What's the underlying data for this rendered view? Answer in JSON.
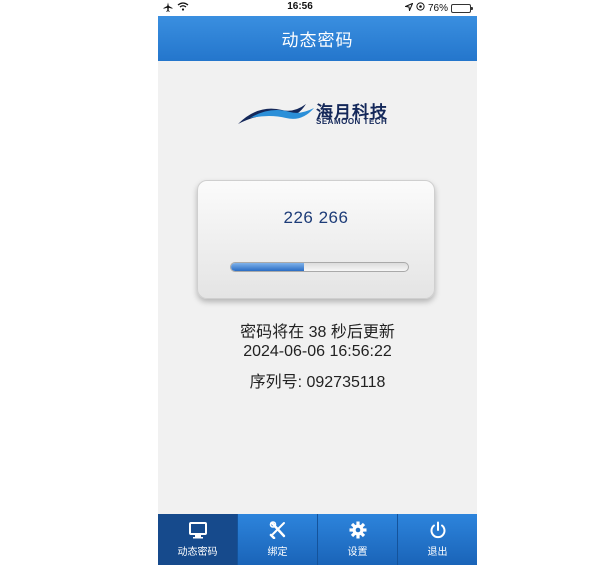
{
  "status_bar": {
    "time": "16:56",
    "battery": "76%",
    "battery_level": 0.76
  },
  "header": {
    "title": "动态密码"
  },
  "logo": {
    "name_cn": "海月科技",
    "name_en": "SEAMOON TECH"
  },
  "token": {
    "code": "226 266",
    "progress": 0.41
  },
  "info": {
    "refresh_text": "密码将在 38 秒后更新",
    "datetime": "2024-06-06 16:56:22",
    "serial": "序列号: 092735118"
  },
  "tabs": [
    {
      "label": "动态密码",
      "icon": "monitor-icon",
      "active": true
    },
    {
      "label": "绑定",
      "icon": "tools-icon",
      "active": false
    },
    {
      "label": "设置",
      "icon": "gear-icon",
      "active": false
    },
    {
      "label": "退出",
      "icon": "power-icon",
      "active": false
    }
  ],
  "colors": {
    "header_blue": "#2a7fd6",
    "tab_active": "#164a8c",
    "code_text": "#1d3c78"
  }
}
